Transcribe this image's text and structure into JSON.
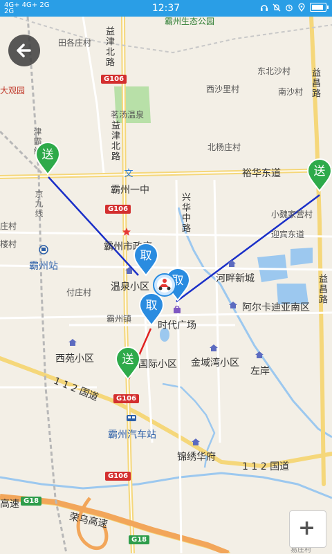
{
  "status_bar": {
    "net1": "4G+ 4G+ 2G",
    "net2": "2G",
    "time": "12:37"
  },
  "map": {
    "labels": {
      "bazhou_ecology_park": "霸州生态公园",
      "tiangezhuang": "田各庄村",
      "yijin_north_road_top": "益津北路",
      "yijin_north_road_mid": "益津北路",
      "dongbei_sha": "东北沙村",
      "xisha_li": "西沙里村",
      "nansha": "南沙村",
      "daguanyuan": "大观园",
      "mingtang_hotspring": "茗汤温泉",
      "beiyangzhuang": "北杨庄村",
      "yuhua_east_road": "裕华东道",
      "bazhou_no1_middle": "霸州一中",
      "xinghua_middle_road": "兴华中路",
      "xiaowei_camp": "小魏家营村",
      "yingbin_east_road": "迎宾东道",
      "city_gov": "霸州市政府",
      "bazhou_station": "霸州站",
      "wenquan_district": "温泉小区",
      "hepan_new_city": "河畔新城",
      "fuzhuang": "付庄村",
      "aerka_south": "阿尔卡迪亚南区",
      "bazhou_town": "霸州镇",
      "times_square": "时代广场",
      "xiyuan_district": "西苑小区",
      "guoji_district": "国际小区",
      "jinchengwan": "金域湾小区",
      "zuoan": "左岸",
      "road_112_west": "1 1 2 国道",
      "road_112_east": "1 1 2 国道",
      "bazhou_bus_station": "霸州汽车站",
      "jinxiu_huafu": "锦绣华府",
      "rongwu_expressway": "荣乌高速",
      "gaosu_left": "高速",
      "jingjiu_line": "京九线",
      "jinbao_line": "津霸线",
      "yichang_road_top": "益昌路",
      "yichang_road_bottom": "益昌路",
      "zhuang_left": "庄村",
      "lou_left": "楼村",
      "yizhuang_left": "易庄村"
    },
    "shields": {
      "g106_a": "G106",
      "g106_b": "G106",
      "g106_c": "G106",
      "g106_d": "G106",
      "g18_a": "G18",
      "g18_b": "G18"
    },
    "markers": {
      "deliver_label": "送",
      "pickup_label": "取"
    }
  },
  "colors": {
    "status_bar": "#2a9ee6",
    "deliver_marker": "#2eaa4a",
    "pickup_marker": "#2a8ce0",
    "route_blue": "#1a2fc8",
    "route_red": "#e02020"
  },
  "icons": {
    "back": "arrow-left-icon",
    "zoom_in": "plus-icon",
    "rider": "scooter-rider-icon"
  }
}
